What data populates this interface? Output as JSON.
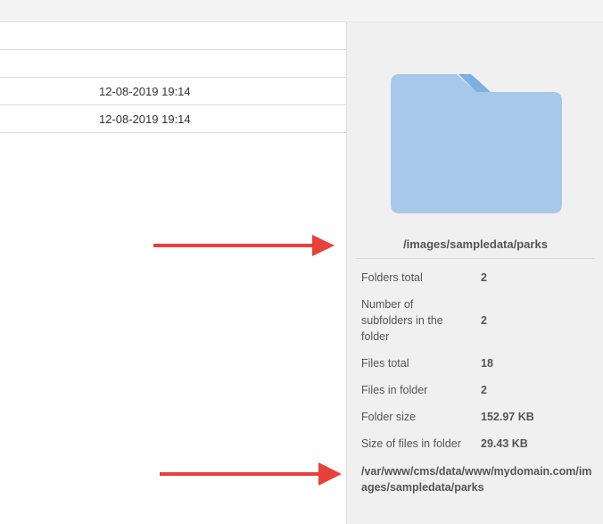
{
  "file_list": {
    "rows": [
      {
        "date": ""
      },
      {
        "date": ""
      },
      {
        "date": "12-08-2019 19:14"
      },
      {
        "date": "12-08-2019 19:14"
      }
    ]
  },
  "details": {
    "folder_icon": "folder-icon",
    "path": "/images/sampledata/parks",
    "properties": [
      {
        "label": "Folders total",
        "value": "2"
      },
      {
        "label": "Number of subfolders in the folder",
        "value": "2"
      },
      {
        "label": "Files total",
        "value": "18"
      },
      {
        "label": "Files in folder",
        "value": "2"
      },
      {
        "label": "Folder size",
        "value": "152.97 KB"
      },
      {
        "label": "Size of files in folder",
        "value": "29.43 KB"
      }
    ],
    "full_path": "/var/www/cms/data/www/mydomain.com/images/sampledata/parks"
  },
  "annotations": {
    "arrow_color": "#e8413a",
    "folder_color": "#a8c8ea",
    "folder_tab_color": "#7faee0"
  }
}
